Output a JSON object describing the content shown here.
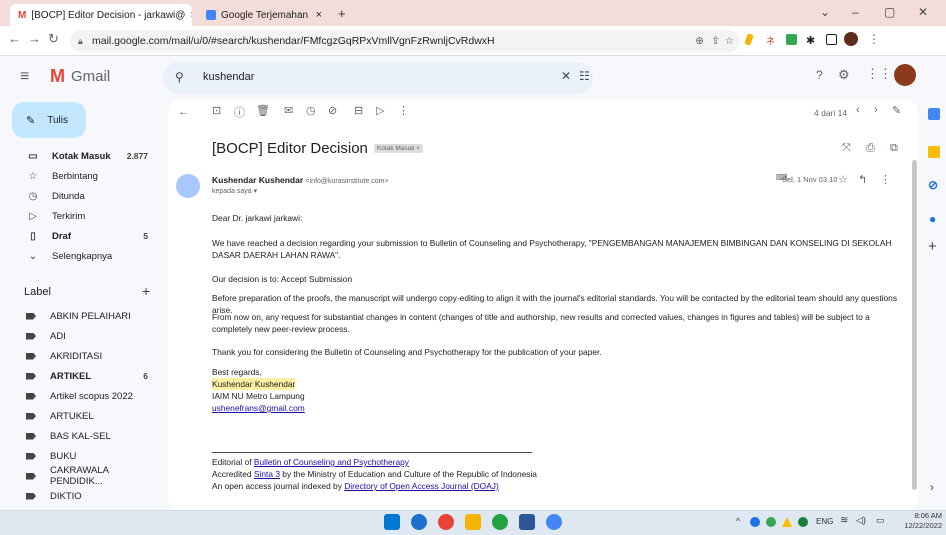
{
  "browser": {
    "tabs": [
      {
        "title": "[BOCP] Editor Decision - jarkawi@",
        "close": "×"
      },
      {
        "title": "Google Terjemahan",
        "close": "×"
      }
    ],
    "new_tab": "+",
    "window_controls": {
      "collapse": "⌄",
      "minimize": "–",
      "maximize": "▢",
      "close": "✕"
    },
    "url": "mail.google.com/mail/u/0/#search/kushendar/FMfcgzGqRPxVmllVgnFzRwnljCvRdwxH"
  },
  "gmail": {
    "logo_text": "Gmail",
    "search_value": "kushendar",
    "compose_label": "Tulis",
    "nav": [
      {
        "label": "Kotak Masuk",
        "count": "2.877",
        "icon": "inbox-icon",
        "bold": true
      },
      {
        "label": "Berbintang",
        "count": "",
        "icon": "star-icon"
      },
      {
        "label": "Ditunda",
        "count": "",
        "icon": "clock-icon"
      },
      {
        "label": "Terkirim",
        "count": "",
        "icon": "send-icon"
      },
      {
        "label": "Draf",
        "count": "5",
        "icon": "draft-icon",
        "bold": true
      },
      {
        "label": "Selengkapnya",
        "count": "",
        "icon": "chevron-down-icon"
      }
    ],
    "label_header": "Label",
    "labels": [
      {
        "label": "ABKIN PELAIHARI",
        "count": ""
      },
      {
        "label": "ADI",
        "count": ""
      },
      {
        "label": "AKRIDITASI",
        "count": ""
      },
      {
        "label": "ARTIKEL",
        "count": "6",
        "bold": true
      },
      {
        "label": "Artikel scopus 2022",
        "count": ""
      },
      {
        "label": "ARTUKEL",
        "count": ""
      },
      {
        "label": "BAS KAL-SEL",
        "count": ""
      },
      {
        "label": "BUKU",
        "count": ""
      },
      {
        "label": "CAKRAWALA PENDIDIK...",
        "count": ""
      },
      {
        "label": "DIKTIO",
        "count": ""
      }
    ],
    "pager": "4 dari 14"
  },
  "email": {
    "subject": "[BOCP] Editor Decision",
    "label_chip": "Kotak Masuk ×",
    "sender_name": "Kushendar Kushendar",
    "sender_email": "<info@kurasinstitute.com>",
    "to": "kepada saya ▾",
    "date": "Sel, 1 Nov 03.10",
    "greeting": "Dear Dr. jarkawi jarkawi:",
    "p1": "We have reached a decision regarding your submission to Bulletin of Counseling and Psychotherapy, \"PENGEMBANGAN MANAJEMEN BIMBINGAN DAN KONSELING DI SEKOLAH DASAR DAERAH LAHAN RAWA\".",
    "p2": "Our decision is to: Accept Submission",
    "p3": "Before preparation of the proofs, the manuscript will undergo copy-editing to align it with the journal's editorial standards. You will be contacted by the editorial team should any questions arise.",
    "p4": "From now on, any request for substantial changes in content (changes of title and authorship, new results and corrected values, changes in figures and tables) will be subject to a completely new peer-review process.",
    "p5": "Thank you for considering the Bulletin of Counseling and Psychotherapy for the publication of your paper.",
    "sig1": "Best regards,",
    "sig2": "Kushendar Kushendar",
    "sig3": "IAIM NU Metro Lampung",
    "sig4": "ushenefrans@gmail.com",
    "f1a": "Editorial of ",
    "f1b": "Bulletin of Counseling and Psychotherapy",
    "f2a": "Accredited ",
    "f2b": "Sinta 3",
    "f2c": " by the Ministry of Education and Culture of the Republic of Indonesia",
    "f3a": "An open access journal indexed by ",
    "f3b": "Directory of Open Access Journal (DOAJ)"
  },
  "system_tray": {
    "lang": "ENG",
    "time": "8:06 AM",
    "date": "12/22/2022"
  }
}
